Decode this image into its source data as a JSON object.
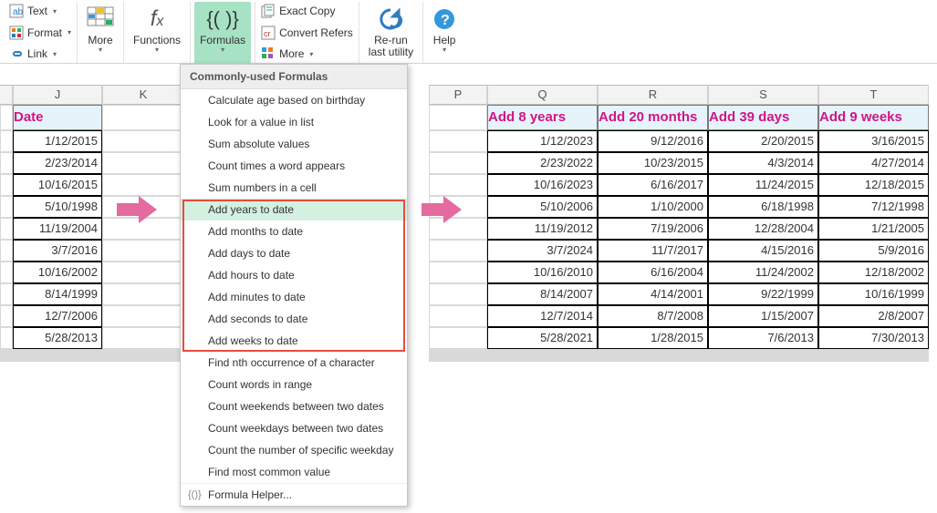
{
  "ribbon": {
    "text_btn": "Text",
    "format_btn": "Format",
    "link_btn": "Link",
    "more1": "More",
    "functions": "Functions",
    "formulas": "Formulas",
    "exact_copy": "Exact Copy",
    "convert_refers": "Convert Refers",
    "more2": "More",
    "rerun": "Re-run\nlast utility",
    "help": "Help"
  },
  "dropdown": {
    "title": "Commonly-used Formulas",
    "items": [
      "Calculate age based on birthday",
      "Look for a value in list",
      "Sum absolute values",
      "Count times a word appears",
      "Sum numbers in a cell",
      "Add years to date",
      "Add months to date",
      "Add days to date",
      "Add hours to date",
      "Add minutes to date",
      "Add seconds to date",
      "Add weeks to date",
      "Find nth occurrence of a character",
      "Count words in range",
      "Count weekends between two dates",
      "Count weekdays between two dates",
      "Count the number of specific weekday",
      "Find most common value"
    ],
    "helper": "Formula Helper..."
  },
  "columns": [
    "J",
    "K",
    "",
    "P",
    "Q",
    "R",
    "S",
    "T"
  ],
  "tableLeft": {
    "header": "Date",
    "rows": [
      "1/12/2015",
      "2/23/2014",
      "10/16/2015",
      "5/10/1998",
      "11/19/2004",
      "3/7/2016",
      "10/16/2002",
      "8/14/1999",
      "12/7/2006",
      "5/28/2013"
    ]
  },
  "tableRight": {
    "headers": [
      "Add 8 years",
      "Add 20 months",
      "Add 39 days",
      "Add 9 weeks"
    ],
    "rows": [
      [
        "1/12/2023",
        "9/12/2016",
        "2/20/2015",
        "3/16/2015"
      ],
      [
        "2/23/2022",
        "10/23/2015",
        "4/3/2014",
        "4/27/2014"
      ],
      [
        "10/16/2023",
        "6/16/2017",
        "11/24/2015",
        "12/18/2015"
      ],
      [
        "5/10/2006",
        "1/10/2000",
        "6/18/1998",
        "7/12/1998"
      ],
      [
        "11/19/2012",
        "7/19/2006",
        "12/28/2004",
        "1/21/2005"
      ],
      [
        "3/7/2024",
        "11/7/2017",
        "4/15/2016",
        "5/9/2016"
      ],
      [
        "10/16/2010",
        "6/16/2004",
        "11/24/2002",
        "12/18/2002"
      ],
      [
        "8/14/2007",
        "4/14/2001",
        "9/22/1999",
        "10/16/1999"
      ],
      [
        "12/7/2014",
        "8/7/2008",
        "1/15/2007",
        "2/8/2007"
      ],
      [
        "5/28/2021",
        "1/28/2015",
        "7/6/2013",
        "7/30/2013"
      ]
    ]
  }
}
